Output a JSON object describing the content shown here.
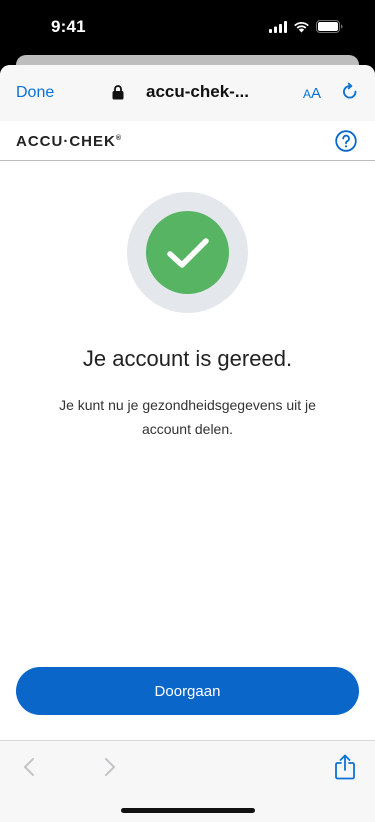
{
  "status_bar": {
    "time": "9:41"
  },
  "browser": {
    "done_label": "Done",
    "url": "accu-chek-...",
    "text_size_label_small": "A",
    "text_size_label_large": "A"
  },
  "header": {
    "logo_text": "ACCU·CHEK",
    "logo_mark": "®"
  },
  "content": {
    "title": "Je account is gereed.",
    "message": "Je kunt nu je gezondheidsgegevens uit je account delen.",
    "continue_label": "Doorgaan"
  },
  "colors": {
    "accent": "#0a66c9",
    "success": "#56b463",
    "ring": "#e4e8ec"
  },
  "icons": {
    "lock": "lock-icon",
    "reload": "reload-icon",
    "help": "help-icon",
    "check": "check-icon",
    "back": "chevron-left-icon",
    "forward": "chevron-right-icon",
    "share": "share-icon"
  }
}
